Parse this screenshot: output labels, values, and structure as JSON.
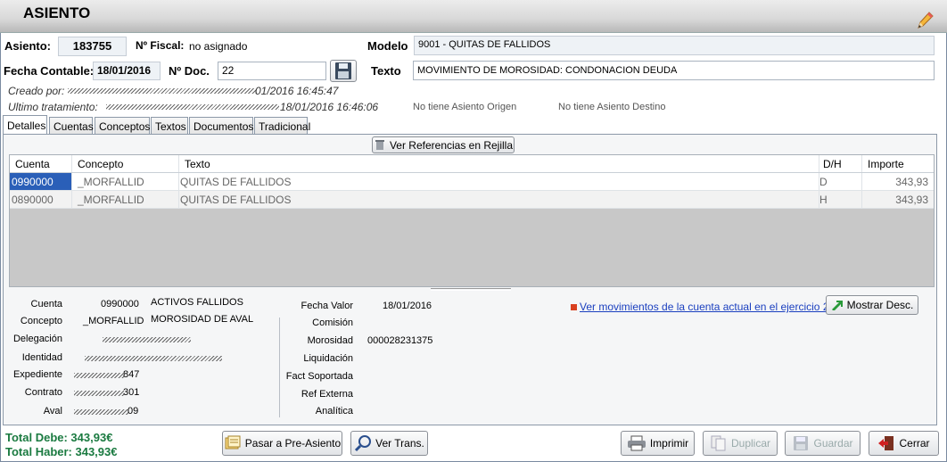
{
  "window": {
    "title": "ASIENTO"
  },
  "header": {
    "asiento_label": "Asiento:",
    "asiento_value": "183755",
    "fiscal_label": "Nº Fiscal:",
    "fiscal_value": "no asignado",
    "modelo_label": "Modelo",
    "modelo_value": "9001 - QUITAS DE FALLIDOS",
    "fecha_label": "Fecha Contable:",
    "fecha_value": "18/01/2016",
    "doc_label": "Nº Doc.",
    "doc_value": "22",
    "texto_label": "Texto",
    "texto_value": "MOVIMIENTO DE MOROSIDAD: CONDONACION DEUDA",
    "creado_label": "Creado por:",
    "creado_time": "01/2016 16:45:47",
    "ultimo_label": "Ultimo tratamiento:",
    "ultimo_time": "18/01/2016 16:46:06",
    "origen": "No tiene Asiento Origen",
    "destino": "No tiene Asiento Destino"
  },
  "tabs": [
    "Detalles",
    "Cuentas",
    "Conceptos",
    "Textos",
    "Documentos",
    "Tradicional"
  ],
  "grid": {
    "ref_button": "Ver Referencias en Rejilla",
    "columns": [
      "Cuenta",
      "Concepto",
      "Texto",
      "D/H",
      "Importe"
    ],
    "rows": [
      {
        "cuenta": "0990000",
        "concepto": "_MORFALLID",
        "texto": "QUITAS DE FALLIDOS",
        "dh": "D",
        "importe": "343,93"
      },
      {
        "cuenta": "0890000",
        "concepto": "_MORFALLID",
        "texto": "QUITAS DE FALLIDOS",
        "dh": "H",
        "importe": "343,93"
      }
    ]
  },
  "detail": {
    "cuenta_label": "Cuenta",
    "cuenta_code": "0990000",
    "cuenta_desc": "ACTIVOS FALLIDOS",
    "concepto_label": "Concepto",
    "concepto_code": "_MORFALLID",
    "concepto_desc": "MOROSIDAD DE AVAL",
    "delegacion_label": "Delegación",
    "identidad_label": "Identidad",
    "expediente_label": "Expediente",
    "expediente_tail": "847",
    "contrato_label": "Contrato",
    "contrato_tail": "301",
    "aval_label": "Aval",
    "aval_tail": "09",
    "fecha_valor_label": "Fecha Valor",
    "fecha_valor": "18/01/2016",
    "comision_label": "Comisión",
    "morosidad_label": "Morosidad",
    "morosidad": "000028231375",
    "liquidacion_label": "Liquidación",
    "fact_label": "Fact Soportada",
    "ref_label": "Ref Externa",
    "analitica_label": "Analítica",
    "link": "Ver movimientos de la cuenta actual en el ejercicio 2016",
    "mostrar_button": "Mostrar Desc."
  },
  "footer": {
    "total_debe": "Total Debe: 343,93€",
    "total_haber": "Total Haber: 343,93€",
    "pre_asiento": "Pasar a Pre-Asiento",
    "ver_trans": "Ver Trans.",
    "imprimir": "Imprimir",
    "duplicar": "Duplicar",
    "guardar": "Guardar",
    "cerrar": "Cerrar"
  },
  "colors": {
    "accent_green": "#1a7a40",
    "link_blue": "#1a3fbf",
    "selected_blue": "#2a5fb8"
  }
}
